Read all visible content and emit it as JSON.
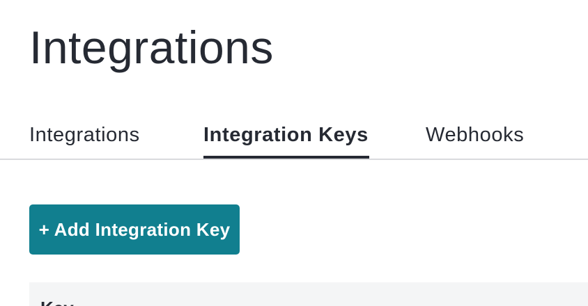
{
  "page": {
    "title": "Integrations"
  },
  "tabs": [
    {
      "label": "Integrations",
      "active": false
    },
    {
      "label": "Integration Keys",
      "active": true
    },
    {
      "label": "Webhooks",
      "active": false
    }
  ],
  "actions": {
    "add_label": "+ Add Integration Key"
  },
  "table": {
    "columns": [
      "Key"
    ]
  },
  "colors": {
    "accent": "#117f8f",
    "text": "#262a33",
    "divider": "#d9dadd",
    "table_header_bg": "#f4f5f6"
  }
}
